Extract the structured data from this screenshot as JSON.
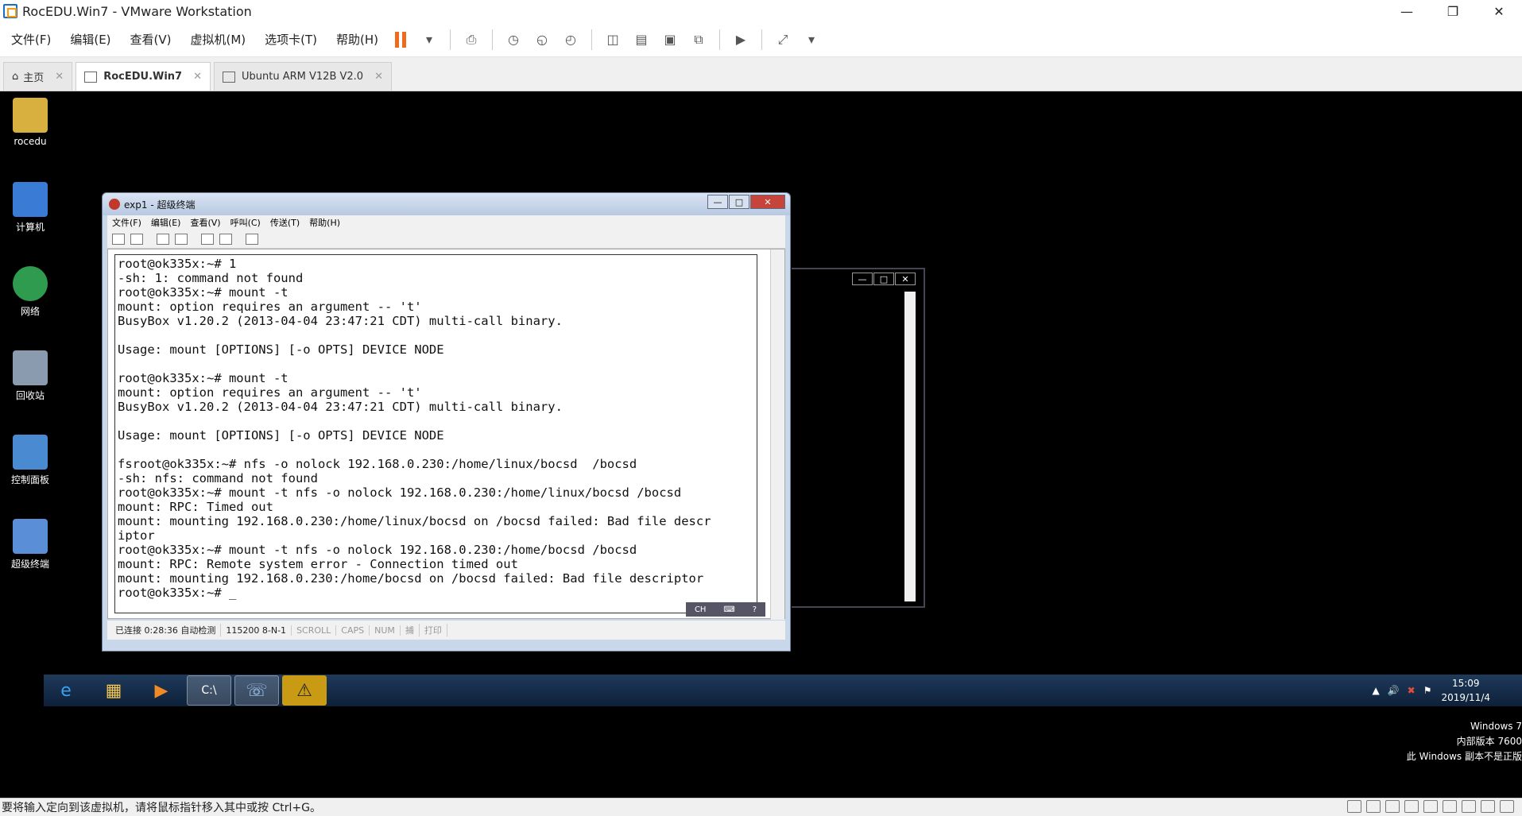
{
  "app": {
    "title": "RocEDU.Win7 - VMware Workstation",
    "menu": [
      "文件(F)",
      "编辑(E)",
      "查看(V)",
      "虚拟机(M)",
      "选项卡(T)",
      "帮助(H)"
    ],
    "tabs": [
      {
        "label": "主页"
      },
      {
        "label": "RocEDU.Win7"
      },
      {
        "label": "Ubuntu ARM V12B V2.0"
      }
    ],
    "status_message": "要将输入定向到该虚拟机，请将鼠标指针移入其中或按 Ctrl+G。"
  },
  "desktop": {
    "icons": [
      {
        "label": "rocedu",
        "color": "#d8b040"
      },
      {
        "label": "计算机",
        "color": "#3a7bd5"
      },
      {
        "label": "网络",
        "color": "#2e9b4e"
      },
      {
        "label": "回收站",
        "color": "#8a9bb0"
      },
      {
        "label": "控制面板",
        "color": "#4a8ad0"
      },
      {
        "label": "超级终端",
        "color": "#5a8fd8"
      }
    ],
    "watermark": [
      "Windows 7",
      "内部版本 7600",
      "此 Windows 副本不是正版"
    ]
  },
  "hyperterminal": {
    "title": "exp1 - 超级终端",
    "menu": [
      "文件(F)",
      "编辑(E)",
      "查看(V)",
      "呼叫(C)",
      "传送(T)",
      "帮助(H)"
    ],
    "terminal_text": "root@ok335x:~# 1\n-sh: 1: command not found\nroot@ok335x:~# mount -t\nmount: option requires an argument -- 't'\nBusyBox v1.20.2 (2013-04-04 23:47:21 CDT) multi-call binary.\n\nUsage: mount [OPTIONS] [-o OPTS] DEVICE NODE\n\nroot@ok335x:~# mount -t\nmount: option requires an argument -- 't'\nBusyBox v1.20.2 (2013-04-04 23:47:21 CDT) multi-call binary.\n\nUsage: mount [OPTIONS] [-o OPTS] DEVICE NODE\n\nfsroot@ok335x:~# nfs -o nolock 192.168.0.230:/home/linux/bocsd  /bocsd\n-sh: nfs: command not found\nroot@ok335x:~# mount -t nfs -o nolock 192.168.0.230:/home/linux/bocsd /bocsd\nmount: RPC: Timed out\nmount: mounting 192.168.0.230:/home/linux/bocsd on /bocsd failed: Bad file descr\niptor\nroot@ok335x:~# mount -t nfs -o nolock 192.168.0.230:/home/bocsd /bocsd\nmount: RPC: Remote system error - Connection timed out\nmount: mounting 192.168.0.230:/home/bocsd on /bocsd failed: Bad file descriptor\nroot@ok335x:~# _",
    "status": {
      "connected": "已连接 0:28:36 自动检测",
      "port": "115200 8-N-1",
      "scroll": "SCROLL",
      "caps": "CAPS",
      "num": "NUM",
      "capture": "捕",
      "print": "打印"
    },
    "ime": "CH"
  },
  "taskbar": {
    "time": "15:09",
    "date": "2019/11/4"
  }
}
